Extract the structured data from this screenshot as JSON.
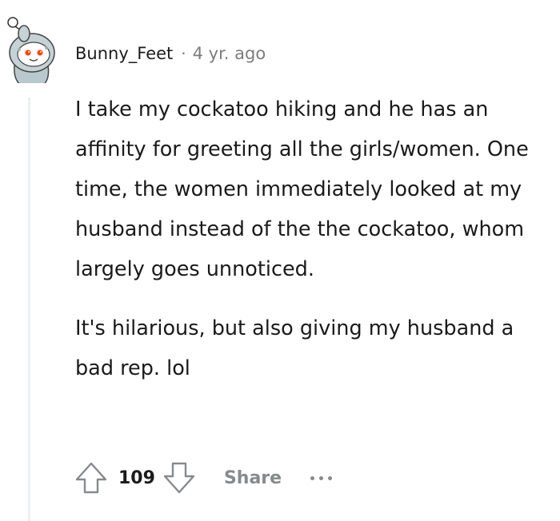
{
  "comment": {
    "author": "Bunny_Feet",
    "separator": "·",
    "age": "4 yr. ago",
    "paragraphs": [
      "I take my cockatoo hiking and he has an affinity for greeting all the girls/women. One time, the women immediately looked at my husband instead of the the cockatoo, whom largely goes unnoticed.",
      "It's hilarious, but also giving my husband a bad rep. lol"
    ],
    "score": "109",
    "share_label": "Share"
  },
  "icons": {
    "avatar": "snoo-avatar-icon",
    "upvote": "upvote-arrow-icon",
    "downvote": "downvote-arrow-icon",
    "more": "more-options-icon"
  },
  "colors": {
    "text": "#1a1a1b",
    "meta": "#7c7c7c",
    "action": "#878a8c",
    "thread_line": "#edeff1"
  }
}
